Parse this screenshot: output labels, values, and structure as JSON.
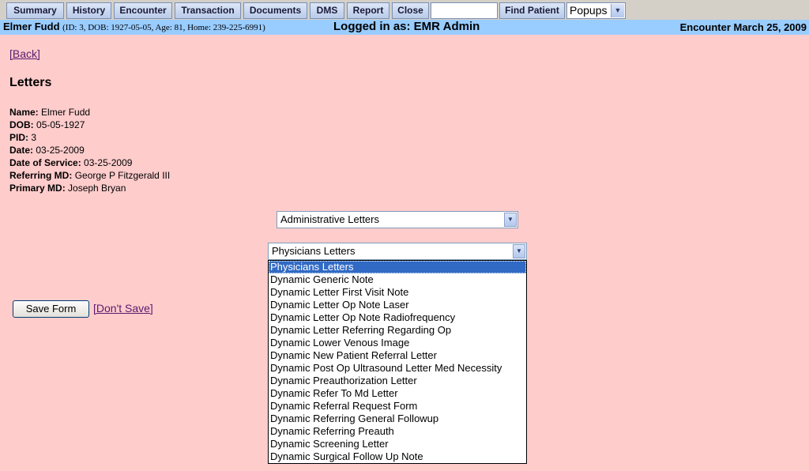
{
  "nav": {
    "buttons": [
      "Summary",
      "History",
      "Encounter",
      "Transaction",
      "Documents",
      "DMS",
      "Report",
      "Close",
      "Find Patient"
    ],
    "search_value": "",
    "popups_value": "Popups"
  },
  "infobar": {
    "patient_name": "Elmer Fudd",
    "patient_meta": "(ID: 3, DOB: 1927-05-05, Age: 81, Home: 239-225-6991)",
    "logged_in": "Logged in as: EMR Admin",
    "encounter": "Encounter March 25, 2009"
  },
  "content": {
    "back_link": "[Back]",
    "title": "Letters",
    "details": [
      {
        "label": "Name:",
        "value": "Elmer Fudd"
      },
      {
        "label": "DOB:",
        "value": "05-05-1927"
      },
      {
        "label": "PID:",
        "value": "3"
      },
      {
        "label": "Date:",
        "value": "03-25-2009"
      },
      {
        "label": "Date of Service:",
        "value": "03-25-2009"
      },
      {
        "label": "Referring MD:",
        "value": "George P Fitzgerald III"
      },
      {
        "label": "Primary MD:",
        "value": "Joseph Bryan"
      }
    ],
    "category_select": "Administrative Letters",
    "letter_select": "Physicians Letters",
    "letter_options": [
      "Physicians Letters",
      "Dynamic Generic Note",
      "Dynamic Letter First Visit Note",
      "Dynamic Letter Op Note Laser",
      "Dynamic Letter Op Note Radiofrequency",
      "Dynamic Letter Referring Regarding Op",
      "Dynamic Lower Venous Image",
      "Dynamic New Patient Referral Letter",
      "Dynamic Post Op Ultrasound Letter Med Necessity",
      "Dynamic Preauthorization Letter",
      "Dynamic Refer To Md Letter",
      "Dynamic Referral Request Form",
      "Dynamic Referring General Followup",
      "Dynamic Referring Preauth",
      "Dynamic Screening Letter",
      "Dynamic Surgical Follow Up Note"
    ],
    "selected_option_index": 0,
    "save_button": "Save Form",
    "dont_save_link": "[Don't Save]"
  }
}
